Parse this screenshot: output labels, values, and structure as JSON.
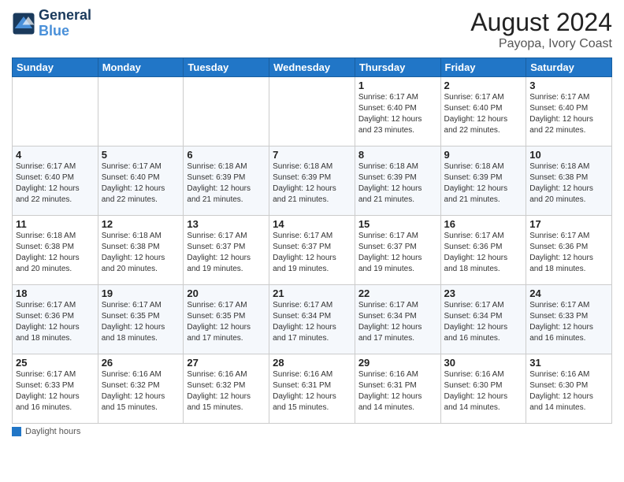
{
  "header": {
    "logo_line1": "General",
    "logo_line2": "Blue",
    "month": "August 2024",
    "location": "Payopa, Ivory Coast"
  },
  "days_of_week": [
    "Sunday",
    "Monday",
    "Tuesday",
    "Wednesday",
    "Thursday",
    "Friday",
    "Saturday"
  ],
  "footer": {
    "box_label": "Daylight hours"
  },
  "weeks": [
    [
      {
        "day": "",
        "info": ""
      },
      {
        "day": "",
        "info": ""
      },
      {
        "day": "",
        "info": ""
      },
      {
        "day": "",
        "info": ""
      },
      {
        "day": "1",
        "info": "Sunrise: 6:17 AM\nSunset: 6:40 PM\nDaylight: 12 hours\nand 23 minutes."
      },
      {
        "day": "2",
        "info": "Sunrise: 6:17 AM\nSunset: 6:40 PM\nDaylight: 12 hours\nand 22 minutes."
      },
      {
        "day": "3",
        "info": "Sunrise: 6:17 AM\nSunset: 6:40 PM\nDaylight: 12 hours\nand 22 minutes."
      }
    ],
    [
      {
        "day": "4",
        "info": "Sunrise: 6:17 AM\nSunset: 6:40 PM\nDaylight: 12 hours\nand 22 minutes."
      },
      {
        "day": "5",
        "info": "Sunrise: 6:17 AM\nSunset: 6:40 PM\nDaylight: 12 hours\nand 22 minutes."
      },
      {
        "day": "6",
        "info": "Sunrise: 6:18 AM\nSunset: 6:39 PM\nDaylight: 12 hours\nand 21 minutes."
      },
      {
        "day": "7",
        "info": "Sunrise: 6:18 AM\nSunset: 6:39 PM\nDaylight: 12 hours\nand 21 minutes."
      },
      {
        "day": "8",
        "info": "Sunrise: 6:18 AM\nSunset: 6:39 PM\nDaylight: 12 hours\nand 21 minutes."
      },
      {
        "day": "9",
        "info": "Sunrise: 6:18 AM\nSunset: 6:39 PM\nDaylight: 12 hours\nand 21 minutes."
      },
      {
        "day": "10",
        "info": "Sunrise: 6:18 AM\nSunset: 6:38 PM\nDaylight: 12 hours\nand 20 minutes."
      }
    ],
    [
      {
        "day": "11",
        "info": "Sunrise: 6:18 AM\nSunset: 6:38 PM\nDaylight: 12 hours\nand 20 minutes."
      },
      {
        "day": "12",
        "info": "Sunrise: 6:18 AM\nSunset: 6:38 PM\nDaylight: 12 hours\nand 20 minutes."
      },
      {
        "day": "13",
        "info": "Sunrise: 6:17 AM\nSunset: 6:37 PM\nDaylight: 12 hours\nand 19 minutes."
      },
      {
        "day": "14",
        "info": "Sunrise: 6:17 AM\nSunset: 6:37 PM\nDaylight: 12 hours\nand 19 minutes."
      },
      {
        "day": "15",
        "info": "Sunrise: 6:17 AM\nSunset: 6:37 PM\nDaylight: 12 hours\nand 19 minutes."
      },
      {
        "day": "16",
        "info": "Sunrise: 6:17 AM\nSunset: 6:36 PM\nDaylight: 12 hours\nand 18 minutes."
      },
      {
        "day": "17",
        "info": "Sunrise: 6:17 AM\nSunset: 6:36 PM\nDaylight: 12 hours\nand 18 minutes."
      }
    ],
    [
      {
        "day": "18",
        "info": "Sunrise: 6:17 AM\nSunset: 6:36 PM\nDaylight: 12 hours\nand 18 minutes."
      },
      {
        "day": "19",
        "info": "Sunrise: 6:17 AM\nSunset: 6:35 PM\nDaylight: 12 hours\nand 18 minutes."
      },
      {
        "day": "20",
        "info": "Sunrise: 6:17 AM\nSunset: 6:35 PM\nDaylight: 12 hours\nand 17 minutes."
      },
      {
        "day": "21",
        "info": "Sunrise: 6:17 AM\nSunset: 6:34 PM\nDaylight: 12 hours\nand 17 minutes."
      },
      {
        "day": "22",
        "info": "Sunrise: 6:17 AM\nSunset: 6:34 PM\nDaylight: 12 hours\nand 17 minutes."
      },
      {
        "day": "23",
        "info": "Sunrise: 6:17 AM\nSunset: 6:34 PM\nDaylight: 12 hours\nand 16 minutes."
      },
      {
        "day": "24",
        "info": "Sunrise: 6:17 AM\nSunset: 6:33 PM\nDaylight: 12 hours\nand 16 minutes."
      }
    ],
    [
      {
        "day": "25",
        "info": "Sunrise: 6:17 AM\nSunset: 6:33 PM\nDaylight: 12 hours\nand 16 minutes."
      },
      {
        "day": "26",
        "info": "Sunrise: 6:16 AM\nSunset: 6:32 PM\nDaylight: 12 hours\nand 15 minutes."
      },
      {
        "day": "27",
        "info": "Sunrise: 6:16 AM\nSunset: 6:32 PM\nDaylight: 12 hours\nand 15 minutes."
      },
      {
        "day": "28",
        "info": "Sunrise: 6:16 AM\nSunset: 6:31 PM\nDaylight: 12 hours\nand 15 minutes."
      },
      {
        "day": "29",
        "info": "Sunrise: 6:16 AM\nSunset: 6:31 PM\nDaylight: 12 hours\nand 14 minutes."
      },
      {
        "day": "30",
        "info": "Sunrise: 6:16 AM\nSunset: 6:30 PM\nDaylight: 12 hours\nand 14 minutes."
      },
      {
        "day": "31",
        "info": "Sunrise: 6:16 AM\nSunset: 6:30 PM\nDaylight: 12 hours\nand 14 minutes."
      }
    ]
  ]
}
